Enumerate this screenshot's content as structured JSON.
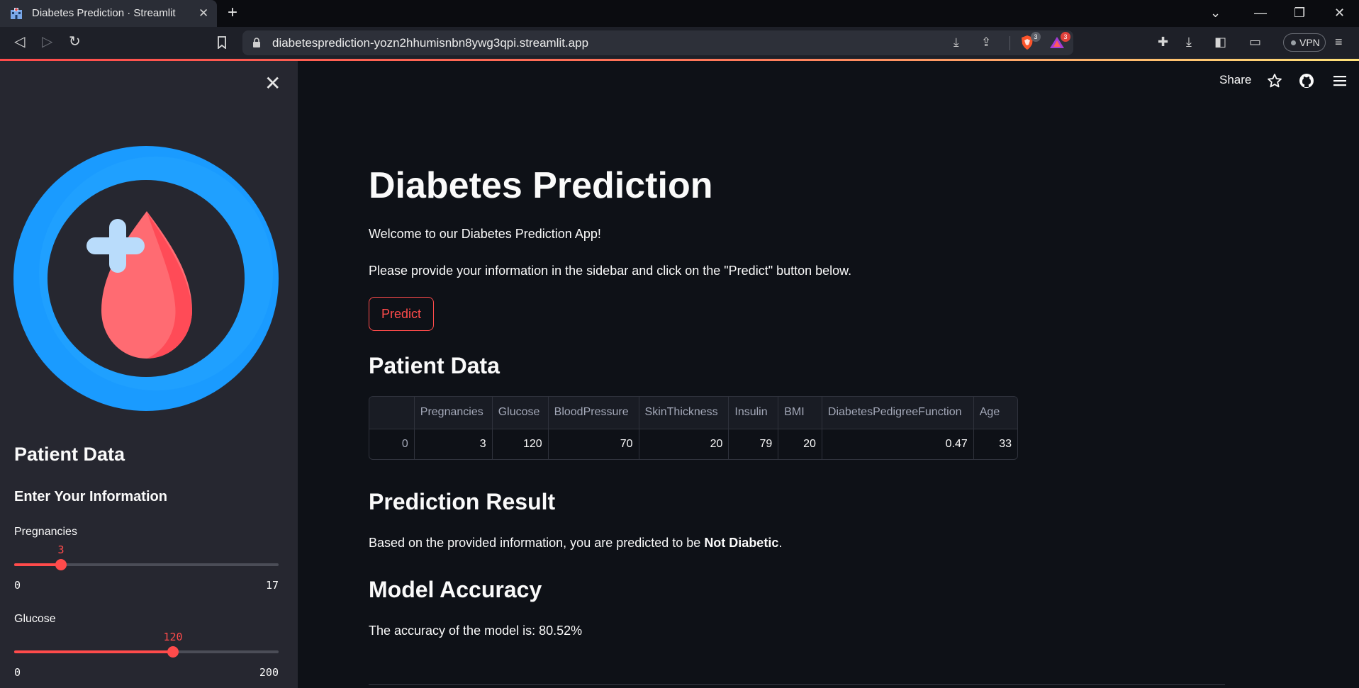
{
  "browser": {
    "tab_title": "Diabetes Prediction · Streamlit",
    "new_tab": "+",
    "url": "diabetesprediction-yozn2hhumisnbn8ywg3qpi.streamlit.app",
    "shield_badge": "3",
    "rewards_badge": "3",
    "vpn_label": "VPN",
    "colors": {
      "tab_bg": "#2a2d36",
      "toolbar_bg": "#1e2028",
      "accent": "#ff4b4b"
    }
  },
  "sidebar": {
    "heading": "Patient Data",
    "subheading": "Enter Your Information",
    "logo": "blood-drop-logo",
    "sliders": [
      {
        "label": "Pregnancies",
        "value": "3",
        "min": "0",
        "max": "17",
        "fraction": 0.1765
      },
      {
        "label": "Glucose",
        "value": "120",
        "min": "0",
        "max": "200",
        "fraction": 0.6
      }
    ]
  },
  "header": {
    "share_label": "Share"
  },
  "main": {
    "title": "Diabetes Prediction",
    "welcome": "Welcome to our Diabetes Prediction App!",
    "instructions": "Please provide your information in the sidebar and click on the \"Predict\" button below.",
    "predict_label": "Predict",
    "patient_heading": "Patient Data",
    "table": {
      "columns": [
        "",
        "Pregnancies",
        "Glucose",
        "BloodPressure",
        "SkinThickness",
        "Insulin",
        "BMI",
        "DiabetesPedigreeFunction",
        "Age"
      ],
      "rows": [
        [
          "0",
          "3",
          "120",
          "70",
          "20",
          "79",
          "20",
          "0.47",
          "33"
        ]
      ]
    },
    "result_heading": "Prediction Result",
    "result_prefix": "Based on the provided information, you are predicted to be ",
    "result_value": "Not Diabetic",
    "result_suffix": ".",
    "accuracy_heading": "Model Accuracy",
    "accuracy_text": "The accuracy of the model is: 80.52%"
  }
}
